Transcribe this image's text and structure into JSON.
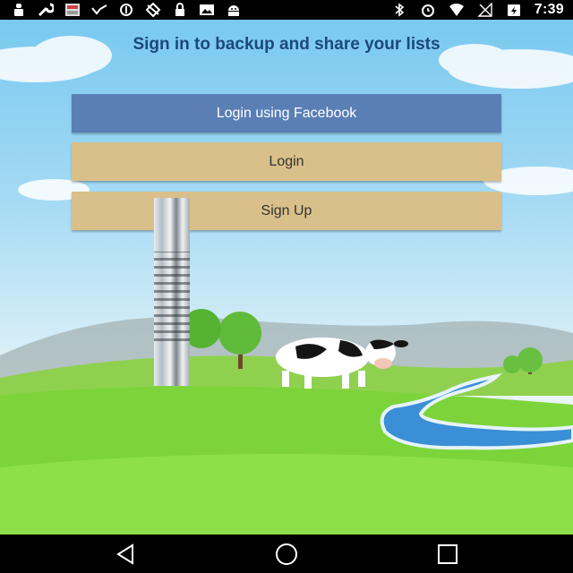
{
  "status_bar": {
    "time": "7:39",
    "left_icons": [
      "notification-icon",
      "wrench-icon",
      "app-thumbnail-icon",
      "missed-call-icon",
      "no-signal-icon",
      "location-off-icon",
      "lock-icon",
      "image-icon",
      "android-icon"
    ],
    "right_icons": [
      "bluetooth-icon",
      "alarm-icon",
      "wifi-icon",
      "cellular-off-icon",
      "battery-charging-icon"
    ]
  },
  "screen": {
    "title": "Sign in to backup and share your lists",
    "buttons": {
      "facebook": "Login using Facebook",
      "login": "Login",
      "signup": "Sign Up"
    }
  },
  "nav_bar": {
    "icons": [
      "back-icon",
      "home-icon",
      "recents-icon"
    ]
  },
  "colors": {
    "facebook_button": "#5a7fb5",
    "wood_button": "#d9c08a",
    "title_text": "#1b4a78",
    "sky": "#79c9f0",
    "grass": "#7cd43a"
  }
}
